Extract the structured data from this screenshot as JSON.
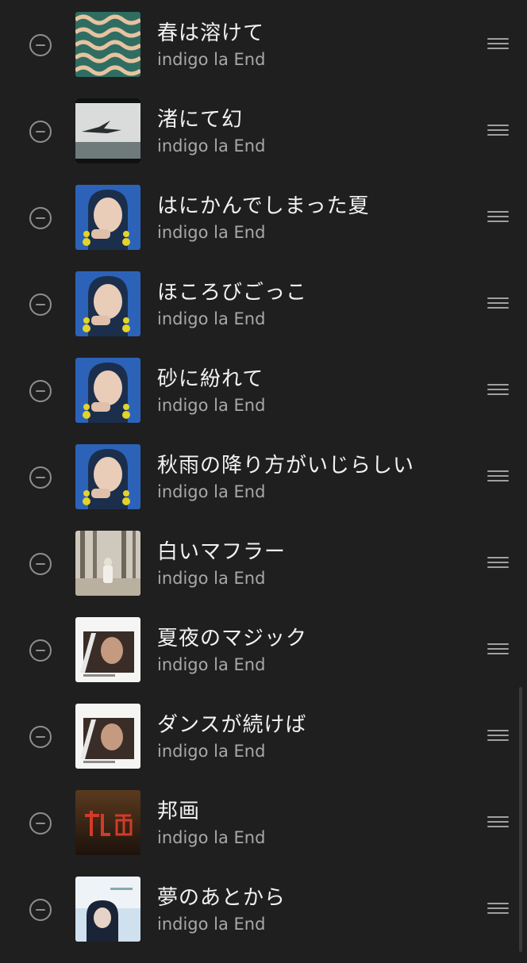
{
  "tracks": [
    {
      "title": "春は溶けて",
      "artist": "indigo la End",
      "art_icon": "album-art-wavy-green"
    },
    {
      "title": "渚にて幻",
      "artist": "indigo la End",
      "art_icon": "album-art-bird-sky"
    },
    {
      "title": "はにかんでしまった夏",
      "artist": "indigo la End",
      "art_icon": "album-art-portrait-blue"
    },
    {
      "title": "ほころびごっこ",
      "artist": "indigo la End",
      "art_icon": "album-art-portrait-blue"
    },
    {
      "title": "砂に紛れて",
      "artist": "indigo la End",
      "art_icon": "album-art-portrait-blue"
    },
    {
      "title": "秋雨の降り方がいじらしい",
      "artist": "indigo la End",
      "art_icon": "album-art-portrait-blue"
    },
    {
      "title": "白いマフラー",
      "artist": "indigo la End",
      "art_icon": "album-art-forest"
    },
    {
      "title": "夏夜のマジック",
      "artist": "indigo la End",
      "art_icon": "album-art-portrait-white"
    },
    {
      "title": "ダンスが続けば",
      "artist": "indigo la End",
      "art_icon": "album-art-portrait-white"
    },
    {
      "title": "邦画",
      "artist": "indigo la End",
      "art_icon": "album-art-dark-red"
    },
    {
      "title": "夢のあとから",
      "artist": "indigo la End",
      "art_icon": "album-art-light-blue"
    }
  ],
  "colors": {
    "background": "#1f1f1f",
    "title_text": "#f2f2f2",
    "artist_text": "#a8a8a8",
    "icon_gray": "#8e8e8e"
  }
}
